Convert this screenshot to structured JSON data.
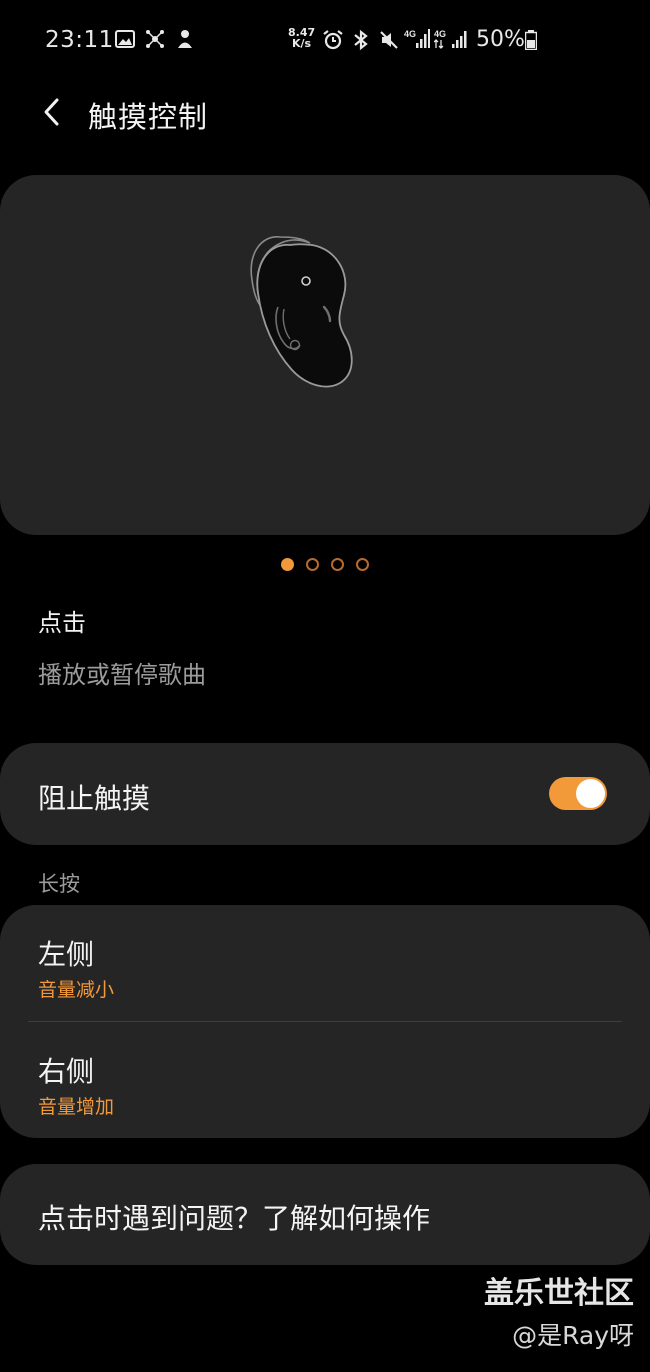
{
  "status_bar": {
    "time": "23:11",
    "net_speed_value": "8.47",
    "net_speed_unit": "K/s",
    "signal_1_label": "4G",
    "signal_2_label": "4G",
    "battery_percent": "50%",
    "icons": [
      "gallery-icon",
      "network-icon",
      "app-icon",
      "alarm-icon",
      "bluetooth-icon",
      "mute-icon",
      "signal-icon",
      "signal-icon",
      "battery-icon"
    ]
  },
  "header": {
    "title": "触摸控制",
    "back_icon": "chevron-left-icon"
  },
  "carousel": {
    "page_count": 4,
    "active_index": 0,
    "accent_color": "#f2993a"
  },
  "tap_section": {
    "title": "点击",
    "description": "播放或暂停歌曲"
  },
  "block_touch": {
    "label": "阻止触摸",
    "enabled": true
  },
  "long_press": {
    "header": "长按",
    "items": [
      {
        "title": "左侧",
        "value": "音量减小"
      },
      {
        "title": "右侧",
        "value": "音量增加"
      }
    ]
  },
  "help": {
    "text": "点击时遇到问题？了解如何操作"
  },
  "watermark": {
    "main": "盖乐世社区",
    "sub": "@是Ray呀"
  },
  "colors": {
    "background": "#000000",
    "card": "#252525",
    "accent": "#f2993a",
    "secondary_text": "#9b9b9b"
  }
}
